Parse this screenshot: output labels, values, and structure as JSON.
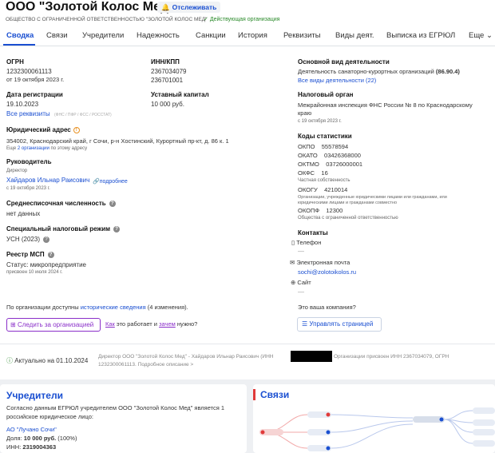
{
  "header": {
    "company_title": "ООО \"Золотой Колос Мед\"",
    "track_label": "Отслеживать",
    "subtitle": "ОБЩЕСТВО С ОГРАНИЧЕННОЙ ОТВЕТСТВЕННОСТЬЮ \"ЗОЛОТОЙ КОЛОС МЕД\"",
    "status": "Действующая организация"
  },
  "tabs": [
    {
      "label": "Сводка"
    },
    {
      "label": "Связи"
    },
    {
      "label": "Учредители"
    },
    {
      "label": "Надежность"
    },
    {
      "label": "Санкции"
    },
    {
      "label": "История"
    },
    {
      "label": "Реквизиты"
    },
    {
      "label": "Виды деят."
    },
    {
      "label": "Выписка из ЕГРЮЛ"
    },
    {
      "label": "Еще"
    }
  ],
  "left": {
    "ogrn_label": "ОГРН",
    "ogrn_value": "1232300061113",
    "ogrn_date": "от 19 октября 2023 г.",
    "reg_label": "Дата регистрации",
    "reg_value": "19.10.2023",
    "reg_link": "Все реквизиты",
    "reg_sources": "(ФНС / ПФР / ФСС / РОССТАТ)",
    "address_label": "Юридический адрес",
    "address_value": "354002, Краснодарский край, г Сочи, р-н Хостинский, Курортный пр-кт, д. 86 к. 1",
    "address_more_prefix": "Еще",
    "address_more_link": "2 организации",
    "address_more_suffix": "по этому адресу",
    "head_label": "Руководитель",
    "head_role": "Директор",
    "head_name": "Хайдаров Ильнар Раисович",
    "head_more": "подробнее",
    "head_date": "с 19 октября 2023 г.",
    "staff_label": "Среднесписочная численность",
    "staff_value": "нет данных",
    "tax_label": "Специальный налоговый режим",
    "tax_value": "УСН (2023)",
    "msp_label": "Реестр МСП",
    "msp_value": "Статус: микропредприятие",
    "msp_date": "присвоен 10 июля 2024 г."
  },
  "middle": {
    "inn_label": "ИНН/КПП",
    "inn_value": "2367034079",
    "kpp_value": "236701001",
    "capital_label": "Уставный капитал",
    "capital_value": "10 000 руб."
  },
  "right": {
    "activity_label": "Основной вид деятельности",
    "activity_value": "Деятельность санаторно-курортных организаций",
    "activity_code": "(86.90.4)",
    "activity_all": "Все виды деятельности (22)",
    "tax_org_label": "Налоговый орган",
    "tax_org_value_1": "Межрайонная инспекция ФНС России № 8 по Краснодарскому",
    "tax_org_value_2": "краю",
    "tax_org_date": "с 19 октября 2023 г.",
    "stat_label": "Коды статистики",
    "okpo": "ОКПО    55578594",
    "okato": "ОКАТО    03426368000",
    "oktmo": "ОКТМО    03726000001",
    "okfs": "ОКФС    16",
    "okfs_desc": "Частная собственность",
    "okogu": "ОКОГУ    4210014",
    "okogu_desc_1": "Организации, учрежденные юридическими лицами или гражданами, или",
    "okogu_desc_2": "юридическими лицами и гражданами совместно",
    "okopf": "ОКОПФ    12300",
    "okopf_desc": "Общества с ограниченной ответственностью",
    "contacts_label": "Контакты",
    "phone_label": "Телефон",
    "phone_value": "—",
    "email_label": "Электронная почта",
    "email_value": "sochi@zolotoikolos.ru",
    "site_label": "Сайт",
    "site_value": "—"
  },
  "bottom": {
    "history_prefix": "По организации доступны",
    "history_link": "исторические сведения",
    "history_suffix": "(4 изменения).",
    "follow_button": "Следить за организацией",
    "how_link": "Как",
    "how_mid": "это работает и",
    "why_link": "зачем",
    "how_suffix": "нужно?",
    "your_company": "Это ваша компания?",
    "manage_button": "Управлять страницей",
    "actual_label": "Актуально на 01.10.2024",
    "actual_desc_1": "Директор ООО \"Золотой Колос Мед\" - Хайдаров Ильнар Раисович (ИНН",
    "actual_desc_2": "Организации присвоен ИНН 2367034079, ОГРН",
    "actual_desc_3": "1232300061113. Подробное описание >"
  },
  "founders_card": {
    "title": "Учредители",
    "text_1": "Согласно данным ЕГРЮЛ учредителем ООО \"Золотой Колос Мед\" является 1",
    "text_2": "российское юридическое лицо:",
    "org_name": "АО \"Лучано Сочи\"",
    "share_label": "Доля:",
    "share_value": "10 000 руб.",
    "share_pct": "(100%)",
    "inn_label": "ИНН:",
    "inn_value": "2319004363"
  },
  "links_card": {
    "title": "Связи"
  },
  "colors": {
    "accent": "#1a4fd1",
    "active_status": "#2a8a2a",
    "follow": "#8a2fc9",
    "graph_red": "#e03a3a",
    "graph_blue": "#1a4fd1"
  }
}
